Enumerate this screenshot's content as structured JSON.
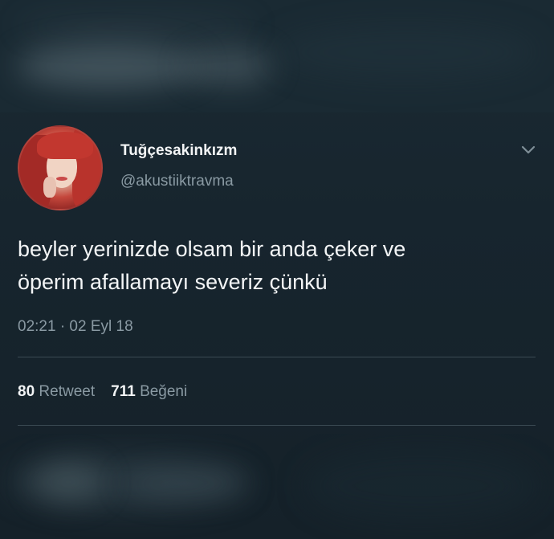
{
  "tweet": {
    "display_name": "Tuğçesakinkızm",
    "handle": "@akustiiktravma",
    "text_line1": "beyler yerinizde olsam bir anda çeker ve",
    "text_line2": "öperim afallamayı severiz çünkü",
    "timestamp": "02:21 · 02 Eyl 18",
    "retweet_count": "80",
    "retweet_label": "Retweet",
    "like_count": "711",
    "like_label": "Beğeni"
  },
  "icons": {
    "menu": "chevron-down-icon",
    "avatar": "profile-photo"
  },
  "colors": {
    "background": "#16232c",
    "primary_text": "#f2f4f5",
    "secondary_text": "#8a9aa3",
    "divider": "#3a4a53"
  }
}
